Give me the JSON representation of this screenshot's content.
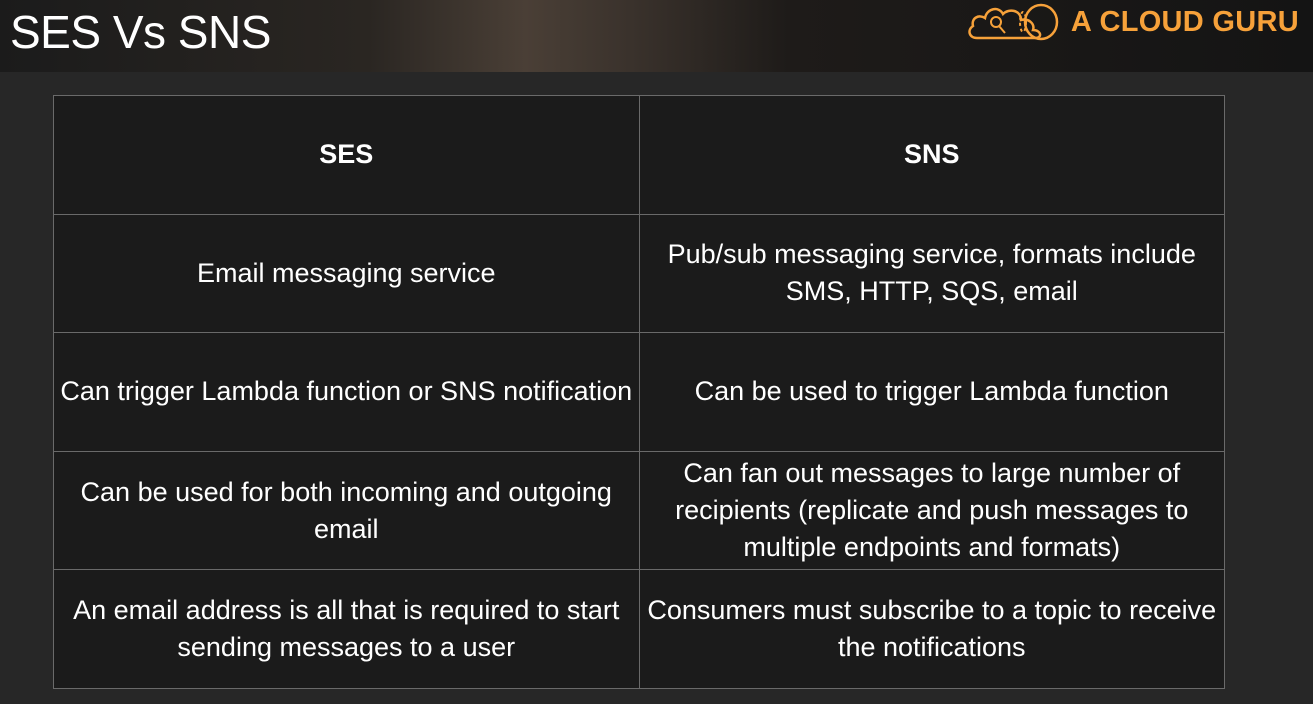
{
  "slide": {
    "title": "SES Vs SNS",
    "brand": {
      "name": "A CLOUD GURU",
      "accent_color": "#f6a13a",
      "logo_icon": "cloud-logo-icon"
    }
  },
  "table": {
    "headers": [
      "SES",
      "SNS"
    ],
    "rows": [
      [
        "Email messaging service",
        "Pub/sub messaging service, formats include SMS, HTTP, SQS, email"
      ],
      [
        "Can trigger Lambda function or SNS notification",
        "Can be used to trigger Lambda function"
      ],
      [
        "Can be used for both incoming and outgoing email",
        "Can fan out messages to large number of recipients (replicate and push messages to multiple endpoints and formats)"
      ],
      [
        "An email address is all that is required to start sending messages to a user",
        "Consumers must subscribe to a topic to receive the notifications"
      ]
    ]
  }
}
